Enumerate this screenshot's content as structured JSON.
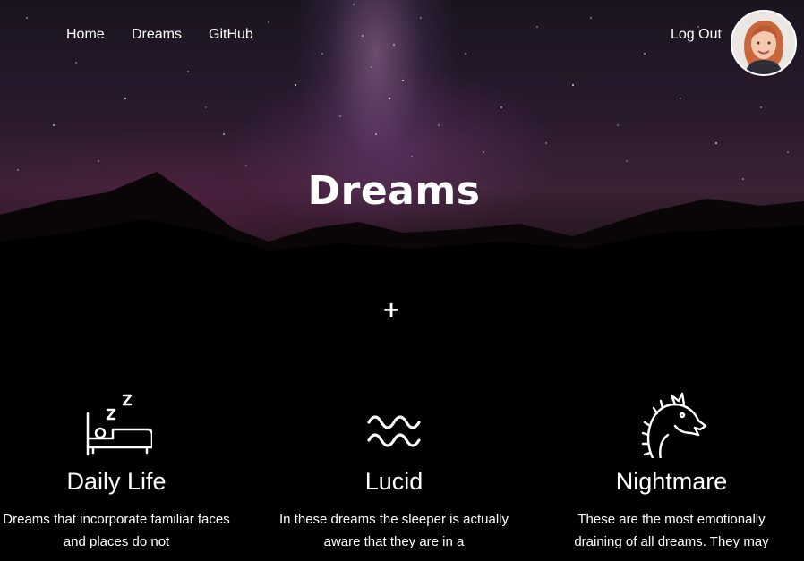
{
  "nav": {
    "items": [
      {
        "label": "Home"
      },
      {
        "label": "Dreams"
      },
      {
        "label": "GitHub"
      }
    ],
    "logout_label": "Log Out"
  },
  "hero": {
    "title": "Dreams"
  },
  "add_button": {
    "label": "+"
  },
  "categories": [
    {
      "icon": "sleeping-bed-icon",
      "title": "Daily Life",
      "description": "Dreams that incorporate familiar faces and places do not"
    },
    {
      "icon": "waves-icon",
      "title": "Lucid",
      "description": "In these dreams the sleeper is actually aware that they are in a"
    },
    {
      "icon": "dragon-icon",
      "title": "Nightmare",
      "description": "These are the most emotionally draining of all dreams. They may"
    }
  ],
  "colors": {
    "background": "#000000",
    "text": "#ffffff",
    "sky": "#2a1a2e"
  }
}
